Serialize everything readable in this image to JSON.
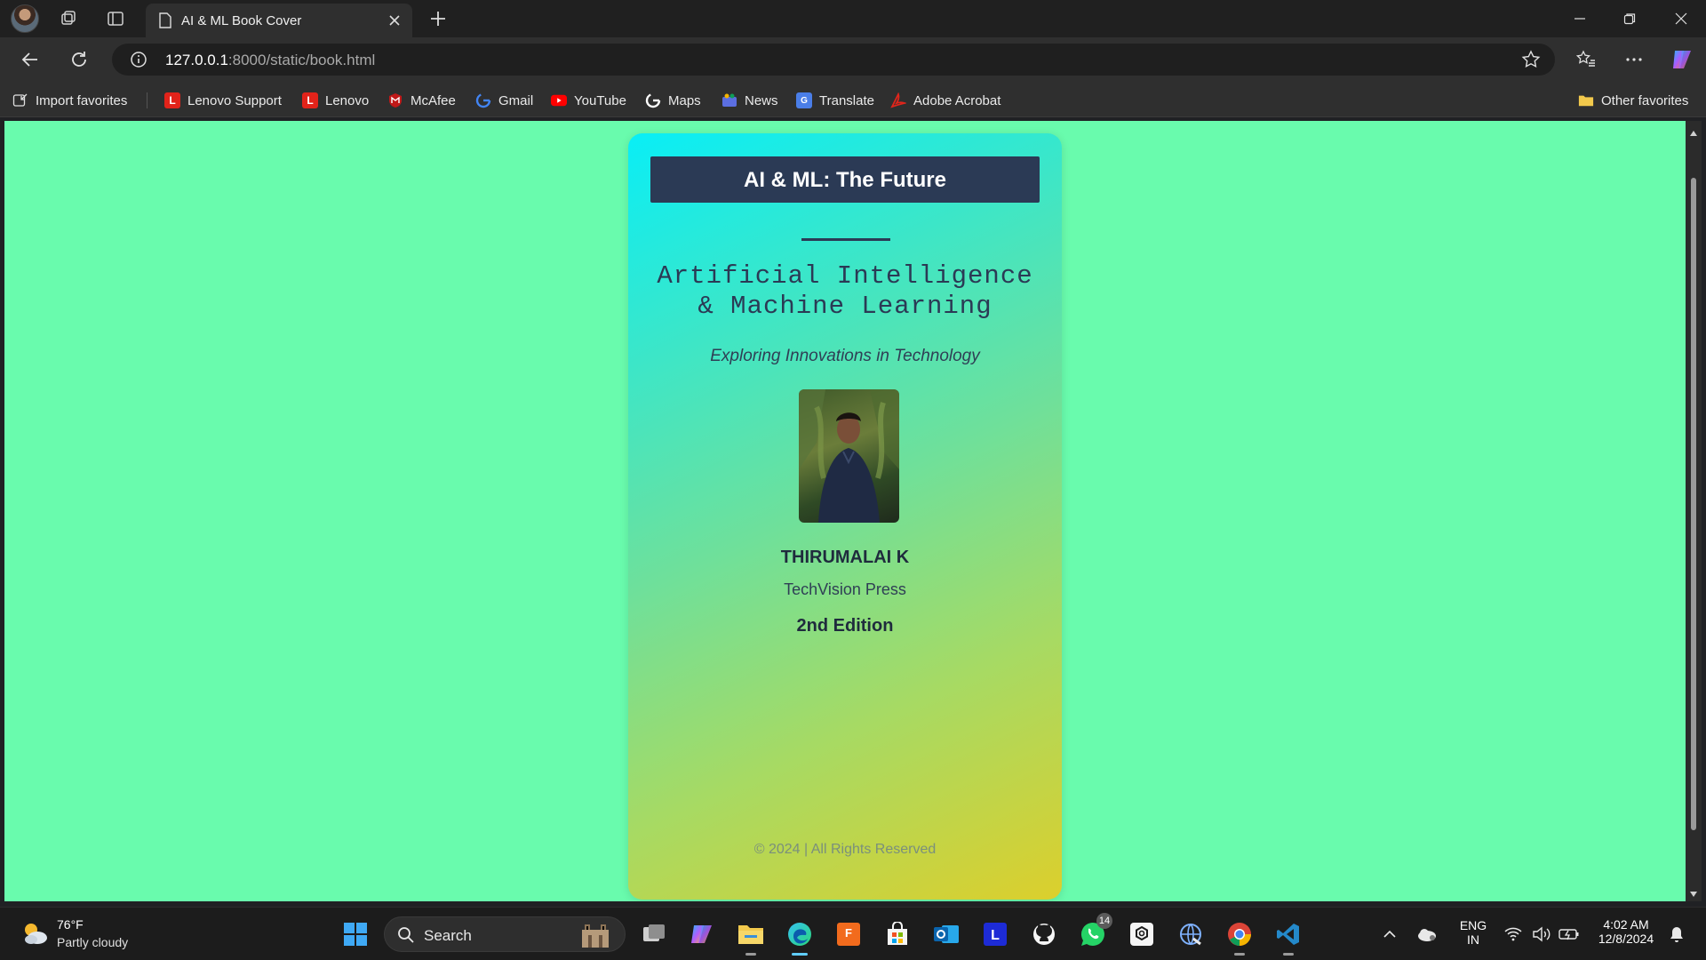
{
  "browser": {
    "tab_title": "AI & ML Book Cover",
    "url_host": "127.0.0.1",
    "url_rest": ":8000/static/book.html"
  },
  "bookmarks": [
    {
      "label": "Import favorites",
      "icon": "import-icon",
      "color": "#e0e0e0"
    },
    {
      "label": "Lenovo Support",
      "icon": "lenovo-icon",
      "color": "#e2231a"
    },
    {
      "label": "Lenovo",
      "icon": "lenovo-icon",
      "color": "#e2231a"
    },
    {
      "label": "McAfee",
      "icon": "mcafee-icon",
      "color": "#c01818"
    },
    {
      "label": "Gmail",
      "icon": "google-icon",
      "color": "#4285f4"
    },
    {
      "label": "YouTube",
      "icon": "youtube-icon",
      "color": "#ff0000"
    },
    {
      "label": "Maps",
      "icon": "google-icon",
      "color": "#4285f4"
    },
    {
      "label": "News",
      "icon": "news-icon",
      "color": "#5b6ee1"
    },
    {
      "label": "Translate",
      "icon": "translate-icon",
      "color": "#4a7ee8"
    },
    {
      "label": "Adobe Acrobat",
      "icon": "acrobat-icon",
      "color": "#e1251b"
    }
  ],
  "other_favorites": "Other favorites",
  "page": {
    "background": "#69fbad",
    "book": {
      "title": "AI & ML: The Future",
      "subtitle_line1": "Artificial Intelligence",
      "subtitle_line2": "& Machine Learning",
      "tagline": "Exploring Innovations in Technology",
      "author": "THIRUMALAI K",
      "publisher": "TechVision Press",
      "edition": "2nd Edition",
      "copyright": "© 2024 | All Rights Reserved",
      "gradient_colors": [
        "#09eef6",
        "#6fe09a",
        "#dccf2c"
      ],
      "title_bar_color": "#2b3a55"
    }
  },
  "taskbar": {
    "weather_temp": "76°F",
    "weather_desc": "Partly cloudy",
    "search_label": "Search",
    "whatsapp_badge": "14",
    "lang_line1": "ENG",
    "lang_line2": "IN",
    "time": "4:02 AM",
    "date": "12/8/2024"
  }
}
